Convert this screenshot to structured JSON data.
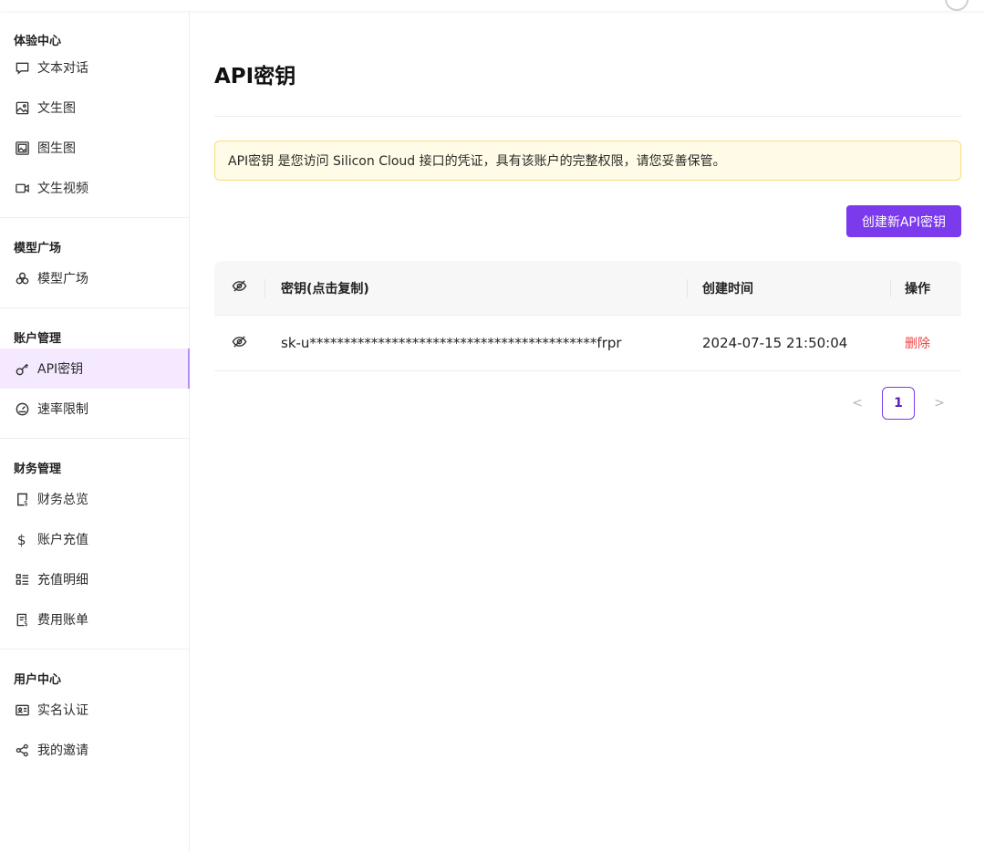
{
  "sidebar": {
    "groups": [
      {
        "title": "体验中心",
        "items": [
          {
            "label": "文本对话",
            "icon": "chat-bubble-icon"
          },
          {
            "label": "文生图",
            "icon": "image-icon"
          },
          {
            "label": "图生图",
            "icon": "image-to-image-icon"
          },
          {
            "label": "文生视频",
            "icon": "video-camera-icon"
          }
        ]
      },
      {
        "title": "模型广场",
        "items": [
          {
            "label": "模型广场",
            "icon": "cubes-icon"
          }
        ]
      },
      {
        "title": "账户管理",
        "items": [
          {
            "label": "API密钥",
            "icon": "key-icon",
            "active": true
          },
          {
            "label": "速率限制",
            "icon": "gauge-icon"
          }
        ]
      },
      {
        "title": "财务管理",
        "items": [
          {
            "label": "财务总览",
            "icon": "billing-doc-icon"
          },
          {
            "label": "账户充值",
            "icon": "dollar-icon"
          },
          {
            "label": "充值明细",
            "icon": "list-detail-icon"
          },
          {
            "label": "费用账单",
            "icon": "invoice-icon"
          }
        ]
      },
      {
        "title": "用户中心",
        "items": [
          {
            "label": "实名认证",
            "icon": "id-card-icon"
          },
          {
            "label": "我的邀请",
            "icon": "share-icon"
          }
        ]
      }
    ]
  },
  "main": {
    "title": "API密钥",
    "notice": "API密钥 是您访问 Silicon Cloud 接口的凭证，具有该账户的完整权限，请您妥善保管。",
    "create_button": "创建新API密钥",
    "table": {
      "headers": {
        "key": "密钥(点击复制)",
        "created": "创建时间",
        "action": "操作"
      },
      "rows": [
        {
          "key": "sk-u******************************************frpr",
          "created": "2024-07-15 21:50:04",
          "action": "删除"
        }
      ]
    },
    "pagination": {
      "current_page": "1",
      "prev": "<",
      "next": ">"
    }
  },
  "colors": {
    "accent": "#7c3aed",
    "active_bg": "#f4e9ff",
    "notice_bg": "#fffbe6",
    "notice_border": "#f5dd86",
    "danger": "#ef4444"
  }
}
